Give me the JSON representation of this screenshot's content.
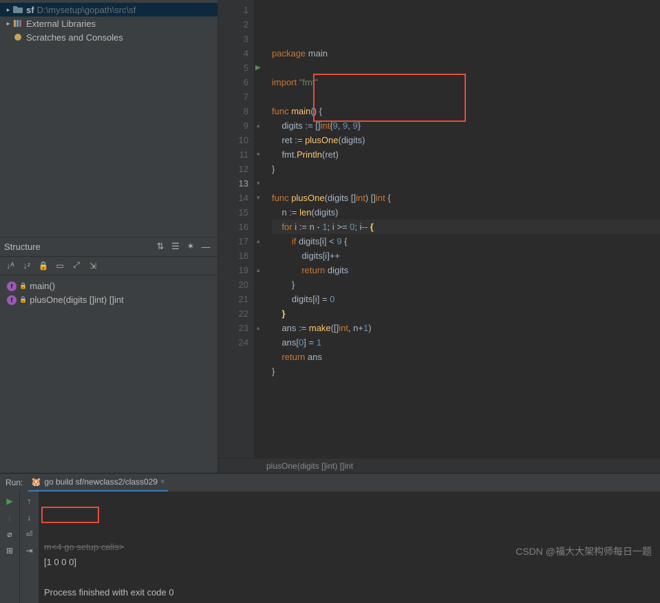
{
  "project": {
    "root_name": "sf",
    "root_path": "D:\\mysetup\\gopath\\src\\sf",
    "external": "External Libraries",
    "scratches": "Scratches and Consoles"
  },
  "structure": {
    "title": "Structure",
    "functions": [
      {
        "name": "main()"
      },
      {
        "name": "plusOne(digits []int) []int"
      }
    ]
  },
  "editor": {
    "breadcrumb": "plusOne(digits []int) []int",
    "lines": [
      {
        "n": 1,
        "tokens": [
          [
            "kw",
            "package "
          ],
          [
            "var",
            "main"
          ]
        ]
      },
      {
        "n": 2,
        "tokens": []
      },
      {
        "n": 3,
        "tokens": [
          [
            "kw",
            "import "
          ],
          [
            "str",
            "\"fmt\""
          ]
        ]
      },
      {
        "n": 4,
        "tokens": []
      },
      {
        "n": 5,
        "run": true,
        "fold": "▾",
        "tokens": [
          [
            "kw",
            "func "
          ],
          [
            "fn",
            "main"
          ],
          [
            "par",
            "() {"
          ]
        ]
      },
      {
        "n": 6,
        "tokens": [
          [
            "var",
            "    digits "
          ],
          [
            "op",
            ":= []"
          ],
          [
            "typ",
            "int"
          ],
          [
            "brc",
            "{"
          ],
          [
            "num",
            "9"
          ],
          [
            "op",
            ", "
          ],
          [
            "num",
            "9"
          ],
          [
            "op",
            ", "
          ],
          [
            "num",
            "9"
          ],
          [
            "brc",
            "}"
          ]
        ]
      },
      {
        "n": 7,
        "tokens": [
          [
            "var",
            "    ret "
          ],
          [
            "op",
            ":= "
          ],
          [
            "fn",
            "plusOne"
          ],
          [
            "par",
            "(digits)"
          ]
        ]
      },
      {
        "n": 8,
        "tokens": [
          [
            "var",
            "    fmt."
          ],
          [
            "fn",
            "Println"
          ],
          [
            "par",
            "(ret)"
          ]
        ]
      },
      {
        "n": 9,
        "fold": "▴",
        "tokens": [
          [
            "brc",
            "}"
          ]
        ]
      },
      {
        "n": 10,
        "tokens": []
      },
      {
        "n": 11,
        "fold": "▾",
        "tokens": [
          [
            "kw",
            "func "
          ],
          [
            "fn",
            "plusOne"
          ],
          [
            "par",
            "(digits []"
          ],
          [
            "typ",
            "int"
          ],
          [
            "par",
            ") []"
          ],
          [
            "typ",
            "int"
          ],
          [
            "par",
            " {"
          ]
        ]
      },
      {
        "n": 12,
        "tokens": [
          [
            "var",
            "    n "
          ],
          [
            "op",
            ":= "
          ],
          [
            "fn",
            "len"
          ],
          [
            "par",
            "(digits)"
          ]
        ]
      },
      {
        "n": 13,
        "hl": true,
        "fold": "▾",
        "tokens": [
          [
            "kw",
            "    for "
          ],
          [
            "var",
            "i "
          ],
          [
            "op",
            ":= "
          ],
          [
            "var",
            "n "
          ],
          [
            "op",
            "- "
          ],
          [
            "num",
            "1"
          ],
          [
            "op",
            "; "
          ],
          [
            "var",
            "i "
          ],
          [
            "op",
            ">= "
          ],
          [
            "num",
            "0"
          ],
          [
            "op",
            "; "
          ],
          [
            "var",
            "i"
          ],
          [
            "op",
            "-- "
          ],
          [
            "hbrc",
            "{"
          ]
        ]
      },
      {
        "n": 14,
        "fold": "▾",
        "tokens": [
          [
            "kw",
            "        if "
          ],
          [
            "var",
            "digits[i] "
          ],
          [
            "op",
            "< "
          ],
          [
            "num",
            "9"
          ],
          [
            "brc",
            " {"
          ]
        ]
      },
      {
        "n": 15,
        "tokens": [
          [
            "var",
            "            digits[i]"
          ],
          [
            "op",
            "++"
          ]
        ]
      },
      {
        "n": 16,
        "tokens": [
          [
            "kw",
            "            return "
          ],
          [
            "var",
            "digits"
          ]
        ]
      },
      {
        "n": 17,
        "fold": "▴",
        "tokens": [
          [
            "brc",
            "        }"
          ]
        ]
      },
      {
        "n": 18,
        "tokens": [
          [
            "var",
            "        digits[i] "
          ],
          [
            "op",
            "= "
          ],
          [
            "num",
            "0"
          ]
        ]
      },
      {
        "n": 19,
        "fold": "▴",
        "tokens": [
          [
            "hbrc",
            "    }"
          ]
        ]
      },
      {
        "n": 20,
        "tokens": [
          [
            "var",
            "    ans "
          ],
          [
            "op",
            ":= "
          ],
          [
            "fn",
            "make"
          ],
          [
            "par",
            "([]"
          ],
          [
            "typ",
            "int"
          ],
          [
            "par",
            ", n"
          ],
          [
            "op",
            "+"
          ],
          [
            "num",
            "1"
          ],
          [
            "par",
            ")"
          ]
        ]
      },
      {
        "n": 21,
        "tokens": [
          [
            "var",
            "    ans["
          ],
          [
            "num",
            "0"
          ],
          [
            "var",
            "] "
          ],
          [
            "op",
            "= "
          ],
          [
            "num",
            "1"
          ]
        ]
      },
      {
        "n": 22,
        "tokens": [
          [
            "kw",
            "    return "
          ],
          [
            "var",
            "ans"
          ]
        ]
      },
      {
        "n": 23,
        "fold": "▴",
        "tokens": [
          [
            "brc",
            "}"
          ]
        ]
      },
      {
        "n": 24,
        "tokens": []
      }
    ]
  },
  "run": {
    "label": "Run:",
    "tab": "go build sf/newclass2/class029",
    "console_lines": [
      {
        "style": "strike",
        "text": "m<4 go setup calls>"
      },
      {
        "style": "",
        "text": "[1 0 0 0]"
      },
      {
        "style": "",
        "text": ""
      },
      {
        "style": "",
        "text": "Process finished with exit code 0"
      }
    ]
  },
  "watermark": "CSDN @福大大架构师每日一题"
}
